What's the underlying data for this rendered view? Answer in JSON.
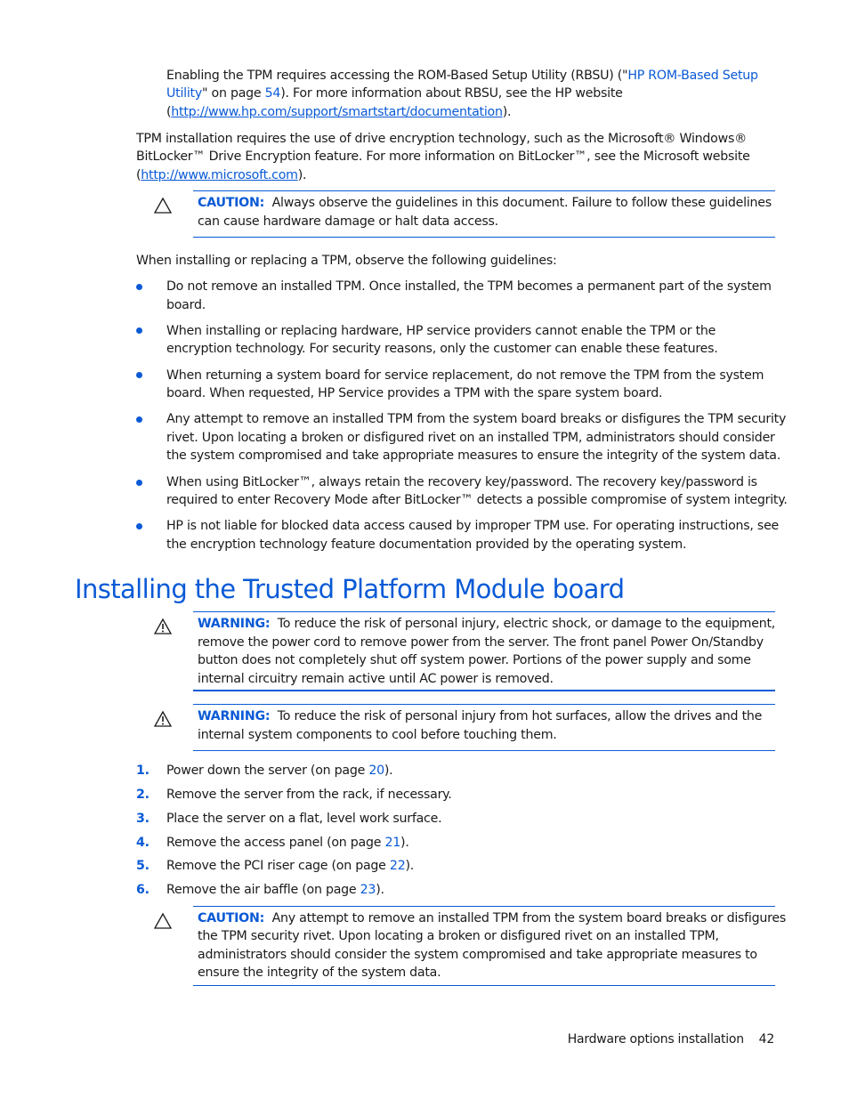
{
  "intro": {
    "rbsu_line1_pre": "Enabling the TPM requires accessing the ROM-Based Setup Utility (RBSU) (\"",
    "rbsu_link_part1": "HP ROM-Based Setup",
    "rbsu_link_part2": "Utility",
    "rbsu_line2_mid": "\" on page ",
    "rbsu_page": "54",
    "rbsu_line2_post": "). For more information about RBSU, see the HP website",
    "rbsu_url_open": "(",
    "rbsu_url": "http://www.hp.com/support/smartstart/documentation",
    "rbsu_url_close": ").",
    "tpm_line1": "TPM installation requires the use of drive encryption technology, such as the Microsoft® Windows®",
    "tpm_line2": "BitLocker™ Drive Encryption feature. For more information on BitLocker™, see the Microsoft website",
    "tpm_url_open": "(",
    "tpm_url": "http://www.microsoft.com",
    "tpm_url_close": ")."
  },
  "caution1": {
    "icon": "caution-triangle-icon",
    "label": "CAUTION:",
    "line1": "Always observe the guidelines in this document. Failure to follow these guidelines",
    "line2": "can cause hardware damage or halt data access."
  },
  "guidelines_intro": "When installing or replacing a TPM, observe the following guidelines:",
  "guidelines": [
    {
      "lines": [
        "Do not remove an installed TPM. Once installed, the TPM becomes a permanent part of the system",
        "board."
      ]
    },
    {
      "lines": [
        "When installing or replacing hardware, HP service providers cannot enable the TPM or the",
        "encryption technology. For security reasons, only the customer can enable these features."
      ]
    },
    {
      "lines": [
        "When returning a system board for service replacement, do not remove the TPM from the system",
        "board. When requested, HP Service provides a TPM with the spare system board."
      ]
    },
    {
      "lines": [
        "Any attempt to remove an installed TPM from the system board breaks or disfigures the TPM security",
        "rivet. Upon locating a broken or disfigured rivet on an installed TPM, administrators should consider",
        "the system compromised and take appropriate measures to ensure the integrity of the system data."
      ]
    },
    {
      "lines": [
        "When using BitLocker™, always retain the recovery key/password. The recovery key/password is",
        "required to enter Recovery Mode after BitLocker™ detects a possible compromise of system integrity."
      ]
    },
    {
      "lines": [
        "HP is not liable for blocked data access caused by improper TPM use. For operating instructions, see",
        "the encryption technology feature documentation provided by the operating system."
      ]
    }
  ],
  "section_heading": "Installing the Trusted Platform Module board",
  "warning1": {
    "icon": "warning-triangle-icon",
    "label": "WARNING:",
    "lines": [
      "To reduce the risk of personal injury, electric shock, or damage to the equipment,",
      "remove the power cord to remove power from the server. The front panel Power On/Standby",
      "button does not completely shut off system power. Portions of the power supply and some",
      "internal circuitry remain active until AC power is removed."
    ]
  },
  "warning2": {
    "icon": "warning-triangle-icon",
    "label": "WARNING:",
    "lines": [
      "To reduce the risk of personal injury from hot surfaces, allow the drives and the",
      "internal system components to cool before touching them."
    ]
  },
  "steps": [
    {
      "num": "1.",
      "text": "Power down the server (on page ",
      "page": "20",
      "end": ")."
    },
    {
      "num": "2.",
      "text": "Remove the server from the rack, if necessary.",
      "page": "",
      "end": ""
    },
    {
      "num": "3.",
      "text": "Place the server on a flat, level work surface.",
      "page": "",
      "end": ""
    },
    {
      "num": "4.",
      "text": "Remove the access panel (on page ",
      "page": "21",
      "end": ")."
    },
    {
      "num": "5.",
      "text": "Remove the PCI riser cage (on page ",
      "page": "22",
      "end": ")."
    },
    {
      "num": "6.",
      "text": "Remove the air baffle (on page ",
      "page": "23",
      "end": ")."
    }
  ],
  "caution2": {
    "icon": "caution-triangle-icon",
    "label": "CAUTION:",
    "lines": [
      "Any attempt to remove an installed TPM from the system board breaks or disfigures",
      "the TPM security rivet. Upon locating a broken or disfigured rivet on an installed TPM,",
      "administrators should consider the system compromised and take appropriate measures to",
      "ensure the integrity of the system data."
    ]
  },
  "footer": {
    "section": "Hardware options installation",
    "page": "42"
  },
  "colors": {
    "accent": "#0a5ad6",
    "text": "#1a1a1a"
  }
}
